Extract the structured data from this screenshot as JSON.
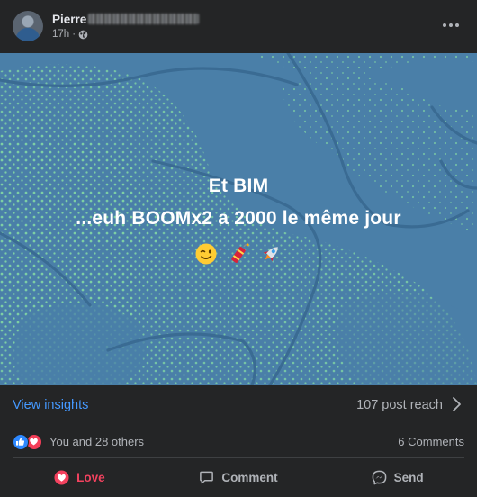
{
  "post": {
    "author_name": "Pierre",
    "time": "17h",
    "separator": "·",
    "more_icon": "more-horizontal-icon",
    "privacy_icon": "globe-icon"
  },
  "media": {
    "line1": "Et BIM",
    "line2": "...euh BOOMx2 a 2000 le même jour",
    "emojis": [
      "winking-face-icon",
      "firecracker-icon",
      "rocket-icon"
    ],
    "colors": {
      "background": "#4a7fa8",
      "dots": "#7ed0a4",
      "lines": "#3a6b93"
    }
  },
  "insights": {
    "link_label": "View insights",
    "reach_label": "107 post reach"
  },
  "reactions": {
    "summary": "You and 28 others",
    "comments": "6 Comments",
    "icons": [
      "like-reaction-icon",
      "love-reaction-icon"
    ]
  },
  "actions": {
    "love": "Love",
    "comment": "Comment",
    "send": "Send"
  },
  "colors": {
    "accent_link": "#4599ff",
    "love": "#f3425f",
    "card": "#242526"
  }
}
